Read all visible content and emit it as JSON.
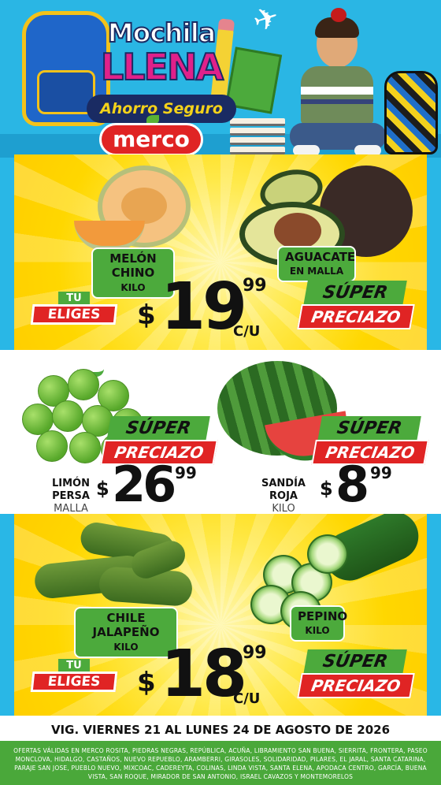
{
  "header": {
    "logo_line1": "Mochila",
    "logo_line2": "LLENA",
    "logo_line3": "Ahorro Seguro",
    "brand": "merco"
  },
  "panel1": {
    "product_left": {
      "name_line1": "MELÓN",
      "name_line2": "CHINO",
      "unit": "KILO"
    },
    "product_right": {
      "name_line1": "AGUACATE",
      "name_line2": "EN MALLA"
    },
    "tu_eliges_top": "TU",
    "tu_eliges_bottom": "ELIGES",
    "price": {
      "currency": "$",
      "integer": "19",
      "decimal": "99",
      "unit": "C/U"
    },
    "super_top": "SÚPER",
    "super_bottom": "PRECIAZO"
  },
  "panel2": {
    "left": {
      "name_line1": "LIMÓN",
      "name_line2": "PERSA",
      "unit": "MALLA",
      "price": {
        "currency": "$",
        "integer": "26",
        "decimal": "99"
      },
      "super_top": "SÚPER",
      "super_bottom": "PRECIAZO"
    },
    "right": {
      "name_line1": "SANDÍA",
      "name_line2": "ROJA",
      "unit": "KILO",
      "price": {
        "currency": "$",
        "integer": "8",
        "decimal": "99"
      },
      "super_top": "SÚPER",
      "super_bottom": "PRECIAZO"
    }
  },
  "panel3": {
    "product_left": {
      "name_line1": "CHILE",
      "name_line2": "JALAPEÑO",
      "unit": "KILO"
    },
    "product_right": {
      "name_line1": "PEPINO",
      "unit": "KILO"
    },
    "tu_eliges_top": "TU",
    "tu_eliges_bottom": "ELIGES",
    "price": {
      "currency": "$",
      "integer": "18",
      "decimal": "99",
      "unit": "C/U"
    },
    "super_top": "SÚPER",
    "super_bottom": "PRECIAZO"
  },
  "footer": {
    "validity": "VIG. VIERNES 21 AL LUNES 24 DE AGOSTO DE 2026",
    "stores": "OFERTAS VÁLIDAS EN MERCO ROSITA, PIEDRAS NEGRAS, REPÚBLICA, ACUÑA, LIBRAMIENTO SAN BUENA, SIERRITA, FRONTERA, PASEO MONCLOVA, HIDALGO, CASTAÑOS, NUEVO REPUEBLO, ARAMBERRI, GIRASOLES, SOLIDARIDAD, PILARES, EL JARAL, SANTA CATARINA, PARAJE SAN JOSE, PUEBLO NUEVO, MIXCOAC, CADEREYTA, COLINAS, LINDA VISTA, SANTA ELENA, APODACA CENTRO, GARCÍA, BUENA VISTA, SAN ROQUE, MIRADOR DE SAN ANTONIO, ISRAEL CAVAZOS Y MONTEMORELOS"
  },
  "colors": {
    "sky": "#2ab6e4",
    "yellow": "#ffd700",
    "green": "#4caa3c",
    "red": "#e02424",
    "navy": "#1a2b63",
    "magenta": "#e0218a"
  }
}
